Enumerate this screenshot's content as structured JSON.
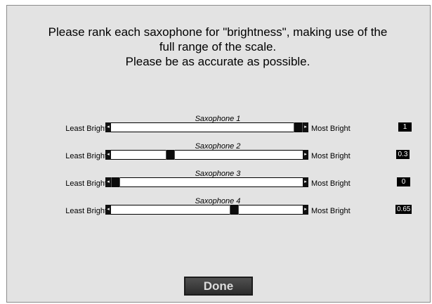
{
  "instructions": {
    "line1": "Please rank each saxophone for \"brightness\", making use of the",
    "line2": "full range of the scale.",
    "line3": "Please be as accurate as possible."
  },
  "sliders": [
    {
      "title": "Saxophone 1",
      "min_label": "Least Bright",
      "max_label": "Most Bright",
      "value": 1,
      "value_text": "1"
    },
    {
      "title": "Saxophone 2",
      "min_label": "Least Bright",
      "max_label": "Most Bright",
      "value": 0.3,
      "value_text": "0.3"
    },
    {
      "title": "Saxophone 3",
      "min_label": "Least Bright",
      "max_label": "Most Bright",
      "value": 0,
      "value_text": "0"
    },
    {
      "title": "Saxophone 4",
      "min_label": "Least Bright",
      "max_label": "Most Bright",
      "value": 0.65,
      "value_text": "0.65"
    }
  ],
  "done_label": "Done",
  "colors": {
    "background": "#e3e3e3",
    "track": "#ffffff",
    "thumb": "#0c0c0c",
    "value_box": "#000000"
  }
}
